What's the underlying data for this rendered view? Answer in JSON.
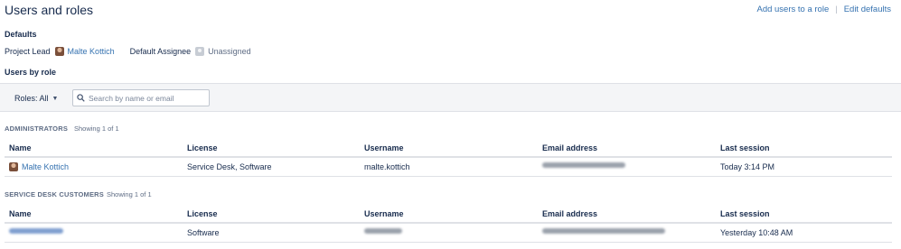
{
  "page": {
    "title": "Users and roles",
    "add_users_link": "Add users to a role",
    "separator": "|",
    "edit_defaults_link": "Edit defaults"
  },
  "defaults": {
    "heading": "Defaults",
    "project_lead_label": "Project Lead",
    "project_lead_name": "Malte Kottich",
    "default_assignee_label": "Default Assignee",
    "default_assignee_value": "Unassigned"
  },
  "users_by_role": {
    "heading": "Users by role",
    "roles_filter_label": "Roles: All",
    "search_placeholder": "Search by name or email"
  },
  "columns": [
    "Name",
    "License",
    "Username",
    "Email address",
    "Last session"
  ],
  "groups": [
    {
      "title": "Administrators",
      "count_text": "Showing 1 of 1",
      "rows": [
        {
          "name": "Malte Kottich",
          "license": "Service Desk, Software",
          "username": "malte.kottich",
          "email": "",
          "last_session": "Today 3:14 PM"
        }
      ]
    },
    {
      "title": "Service Desk Customers",
      "count_text": "Showing 1 of 1",
      "rows": [
        {
          "name": "",
          "license": "Software",
          "username": "",
          "email": "",
          "last_session": "Yesterday 10:48 AM"
        }
      ]
    }
  ],
  "colors": {
    "link": "#3572b0",
    "text": "#172b4d",
    "toolbar_bg": "#f4f5f7",
    "border": "#dfe1e6"
  }
}
